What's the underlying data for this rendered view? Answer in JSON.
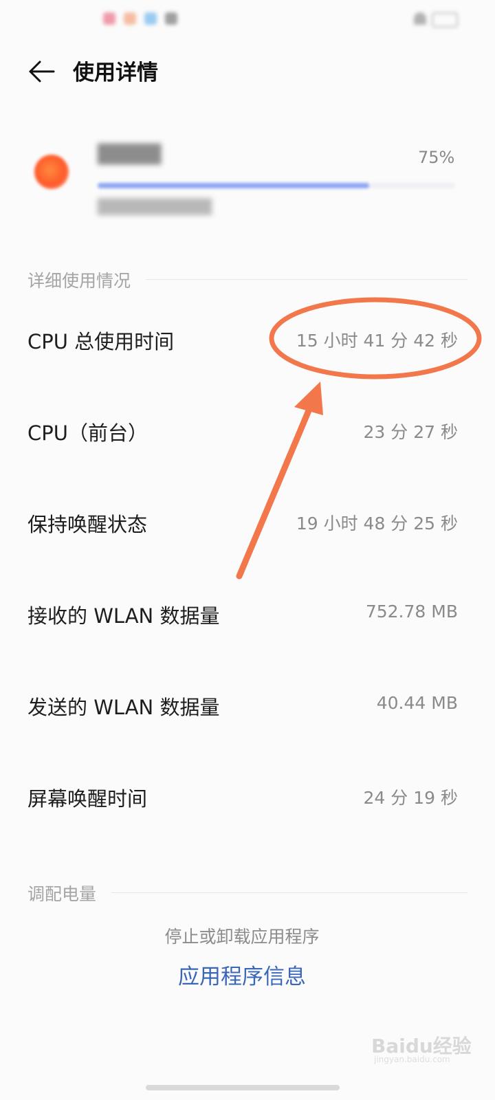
{
  "header": {
    "title": "使用详情",
    "back_icon": "back-arrow-icon"
  },
  "app": {
    "percent_label": "75%",
    "usage_fraction": 0.76
  },
  "sections": {
    "detail_label": "详细使用情况",
    "battery_label": "调配电量"
  },
  "rows": [
    {
      "label": "CPU 总使用时间",
      "value": "15 小时 41 分 42 秒"
    },
    {
      "label": "CPU（前台）",
      "value": "23 分 27 秒"
    },
    {
      "label": "保持唤醒状态",
      "value": "19 小时 48 分 25 秒"
    },
    {
      "label": "接收的 WLAN 数据量",
      "value": "752.78 MB"
    },
    {
      "label": "发送的 WLAN 数据量",
      "value": "40.44 MB"
    },
    {
      "label": "屏幕唤醒时间",
      "value": "24 分 19 秒"
    }
  ],
  "actions": {
    "description": "停止或卸载应用程序",
    "link": "应用程序信息"
  },
  "watermark": {
    "text": "Baidu经验",
    "sub": "jingyan.baidu.com"
  },
  "colors": {
    "accent_link": "#3a66b8",
    "annotation": "#f2784b",
    "progress": "#8fa6f2"
  }
}
